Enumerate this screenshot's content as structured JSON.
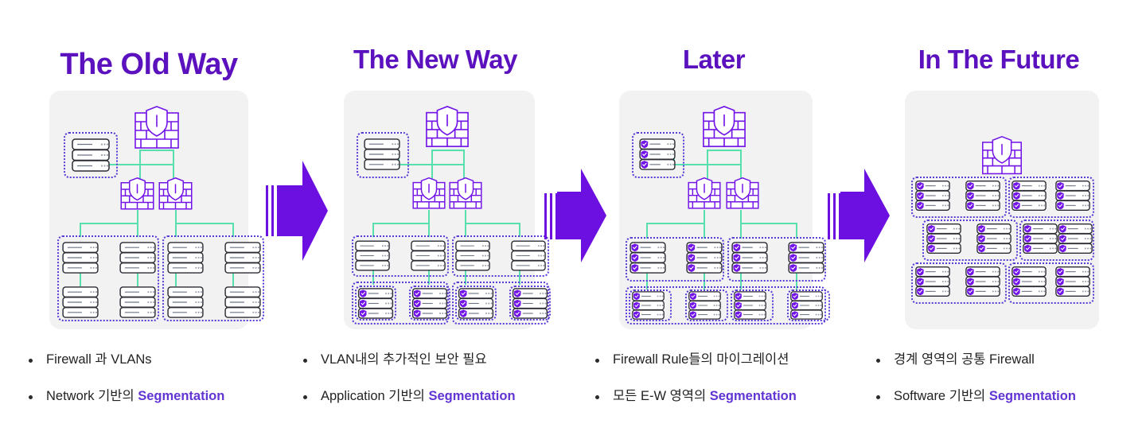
{
  "meta": {
    "colors": {
      "title_purple": "#5B12BE",
      "accent_purple": "#6B10E0",
      "highlight_purple": "#6134D4",
      "connector_green": "#57E0AE",
      "card_gray": "#f2f2f2",
      "dotted_border": "#5B3BD6",
      "text_dark": "#222222"
    }
  },
  "stages": [
    {
      "title": "The Old Way",
      "diagram_name": "old-way-network-diagram",
      "bullets": [
        {
          "lead": "Firewall 과 VLANs",
          "highlight": ""
        },
        {
          "lead": "Network 기반의 ",
          "highlight": "Segmentation"
        }
      ]
    },
    {
      "title": "The New Way",
      "diagram_name": "new-way-network-diagram",
      "bullets": [
        {
          "lead": "VLAN내의 추가적인 보안 필요",
          "highlight": ""
        },
        {
          "lead": "Application 기반의 ",
          "highlight": "Segmentation"
        }
      ]
    },
    {
      "title": "Later",
      "diagram_name": "later-network-diagram",
      "bullets": [
        {
          "lead": "Firewall Rule들의 마이그레이션",
          "highlight": ""
        },
        {
          "lead": "모든 E-W 영역의 ",
          "highlight": "Segmentation"
        }
      ]
    },
    {
      "title": "In The Future",
      "diagram_name": "future-network-diagram",
      "bullets": [
        {
          "lead": "경계 영역의 공통 Firewall",
          "highlight": ""
        },
        {
          "lead": "Software 기반의 ",
          "highlight": "Segmentation"
        }
      ]
    }
  ],
  "arrows": [
    {
      "name": "arrow-old-to-new"
    },
    {
      "name": "arrow-new-to-later"
    },
    {
      "name": "arrow-later-to-future"
    }
  ],
  "icons": {
    "firewall": "firewall-shield-icon",
    "server": "server-rack-icon",
    "server_secured": "secured-server-rack-icon",
    "shield_badge": "shield-check-badge-icon",
    "arrow": "right-arrow-icon",
    "bullet": "bullet-dot-icon"
  }
}
